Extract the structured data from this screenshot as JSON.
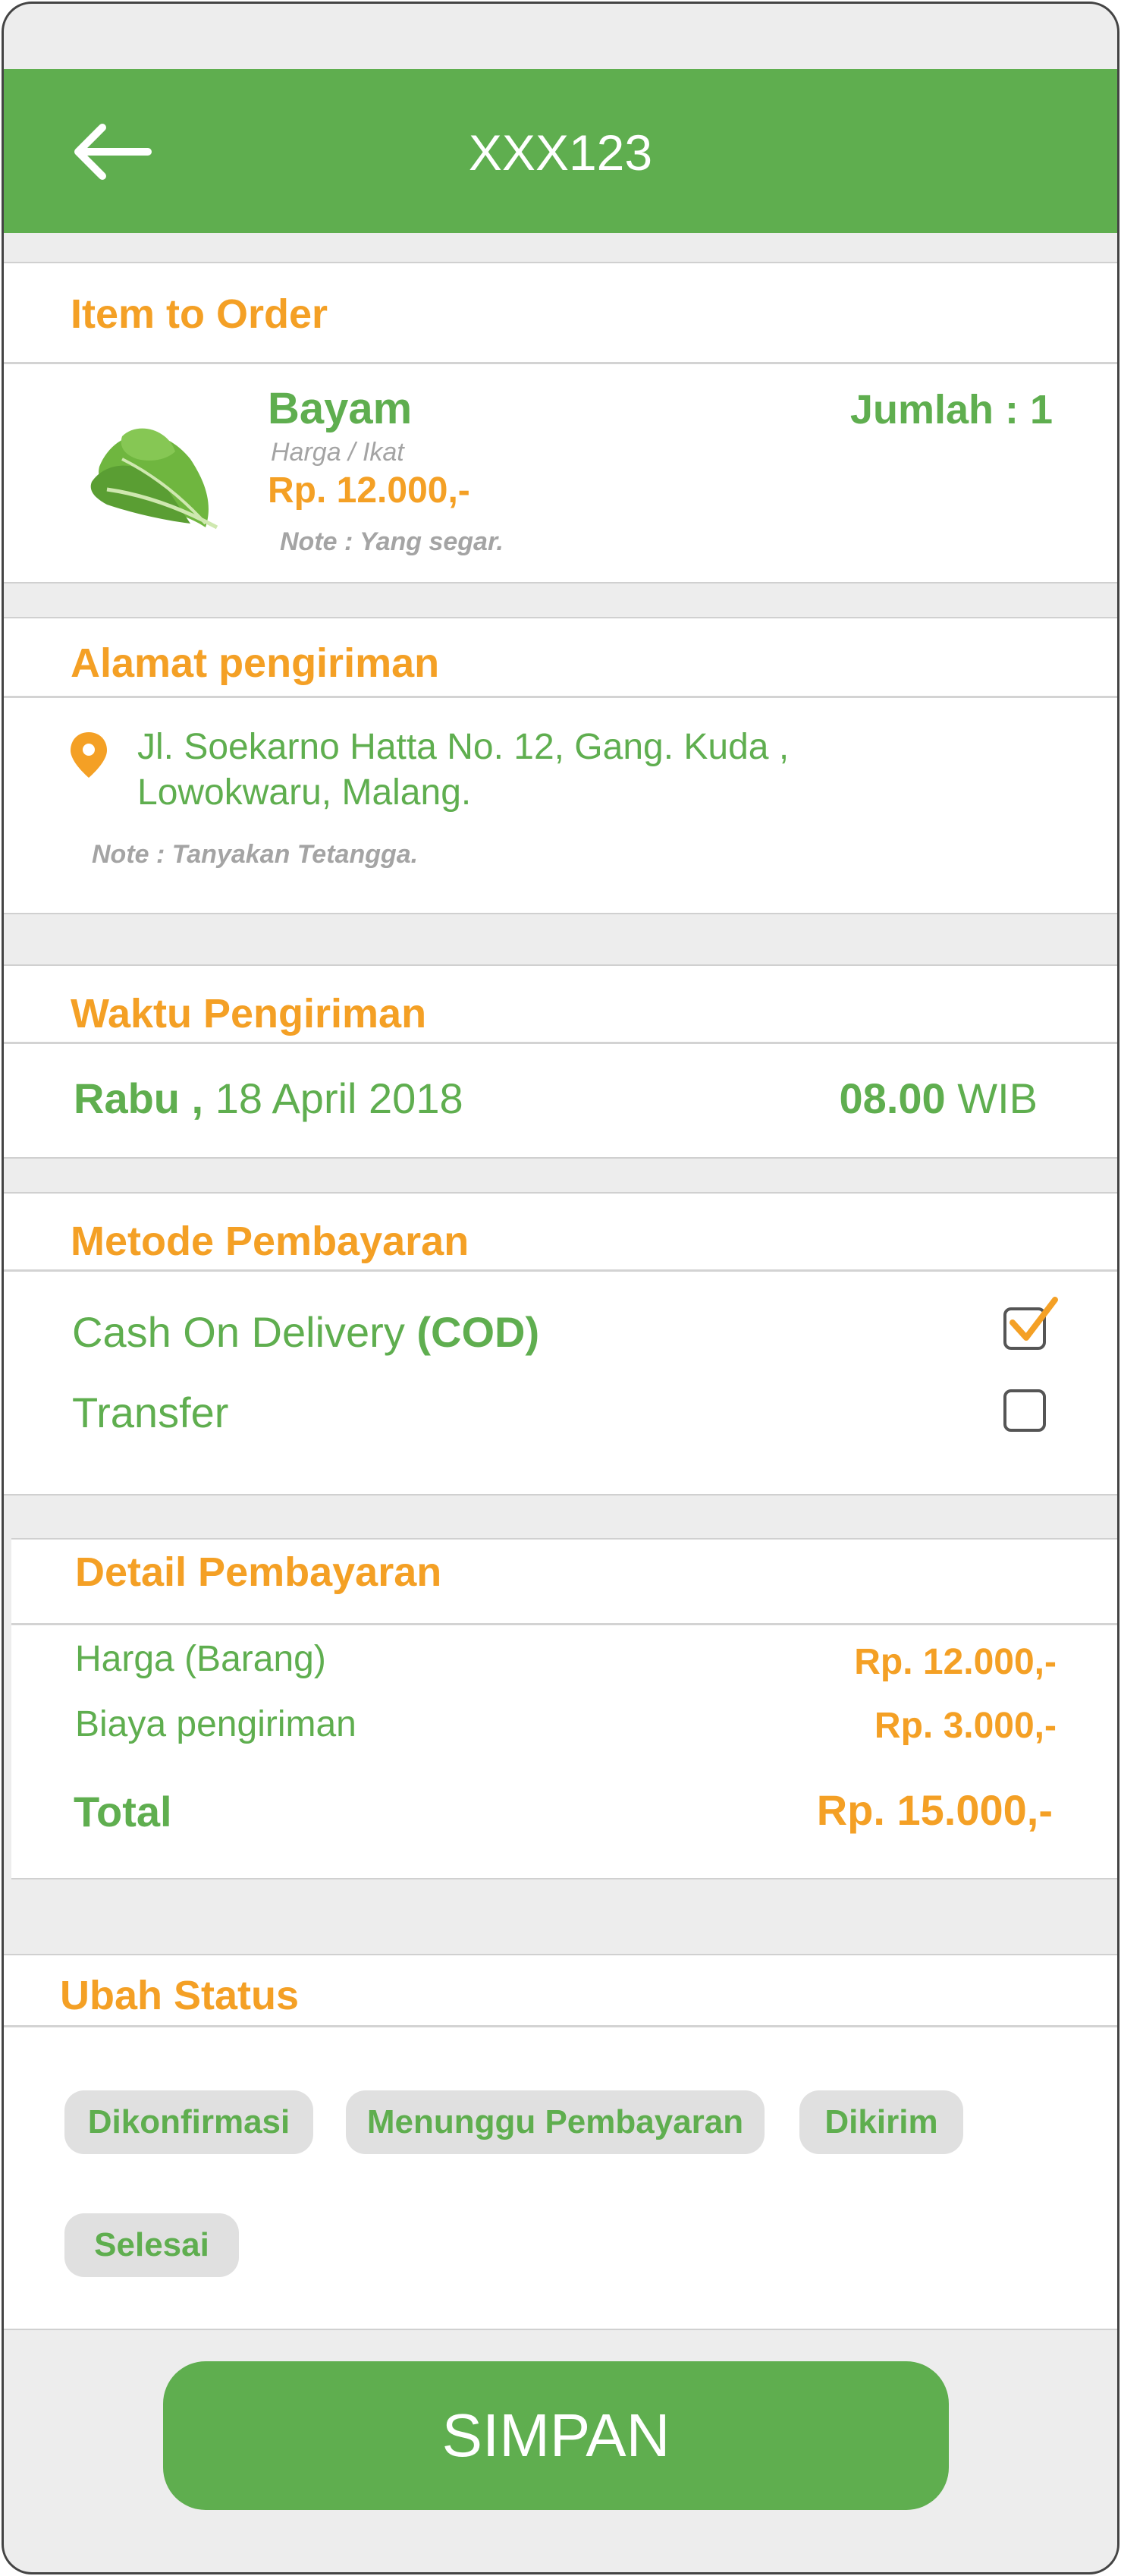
{
  "header": {
    "title": "XXX123"
  },
  "item_section": {
    "heading": "Item to Order",
    "name": "Bayam",
    "unit_label": "Harga / Ikat",
    "price": "Rp. 12.000,-",
    "quantity": "Jumlah : 1",
    "note": "Note : Yang segar."
  },
  "address_section": {
    "heading": "Alamat pengiriman",
    "line1": "Jl. Soekarno Hatta No. 12, Gang. Kuda ,",
    "line2": "Lowokwaru, Malang.",
    "note": "Note : Tanyakan Tetangga."
  },
  "time_section": {
    "heading": "Waktu Pengiriman",
    "day": "Rabu ,",
    "date": "18 April 2018",
    "time": "08.00",
    "zone": "WIB"
  },
  "payment_method": {
    "heading": "Metode Pembayaran",
    "options": [
      {
        "label": "Cash On Delivery",
        "suffix": "(COD)",
        "checked": true
      },
      {
        "label": "Transfer",
        "suffix": "",
        "checked": false
      }
    ]
  },
  "payment_detail": {
    "heading": "Detail Pembayaran",
    "rows": [
      {
        "label": "Harga (Barang)",
        "value": "Rp. 12.000,-"
      },
      {
        "label": "Biaya pengiriman",
        "value": "Rp. 3.000,-"
      }
    ],
    "total_label": "Total",
    "total_value": "Rp. 15.000,-"
  },
  "status_section": {
    "heading": "Ubah Status",
    "options": [
      "Dikonfirmasi",
      "Menunggu Pembayaran",
      "Dikirim",
      "Selesai"
    ]
  },
  "save_label": "SIMPAN",
  "colors": {
    "primary": "#5fae4f",
    "accent": "#f4a025",
    "background": "#ededed"
  }
}
